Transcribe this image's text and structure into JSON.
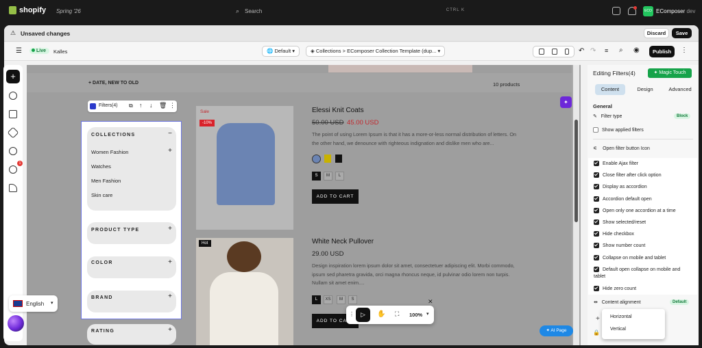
{
  "topbar": {
    "brand": "shopify",
    "edition": "Spring '26",
    "search_placeholder": "Search",
    "shortcut": "CTRL K",
    "avatar_initials": "ECO",
    "store_name": "EComposer",
    "store_suffix": "dev"
  },
  "savebar": {
    "message": "Unsaved changes",
    "discard": "Discard",
    "save": "Save"
  },
  "toolbar": {
    "status": "Live",
    "store": "Kalles",
    "theme": "Default",
    "template": "Collections > EComposer Collection Template (dup...",
    "publish": "Publish"
  },
  "canvas": {
    "sort_label": "DATE, NEW TO OLD",
    "product_count": "10 products",
    "filter_tag": "Filters(4)",
    "filters": {
      "collections_title": "COLLECTIONS",
      "items": [
        "Women Fashion",
        "Watches",
        "Men Fashion",
        "Skin care"
      ],
      "product_type": "PRODUCT TYPE",
      "color": "COLOR",
      "brand": "BRAND",
      "rating": "RATING"
    },
    "products": [
      {
        "badge": "Sale",
        "discount": "-10%",
        "title": "Elessi Knit Coats",
        "old_price": "50.00 USD",
        "price": "45.00 USD",
        "desc": "The point of using Lorem Ipsum is that it has a more-or-less normal distribution of letters. On the other hand, we denounce with righteous indignation and dislike men who are...",
        "sizes": [
          "S",
          "M",
          "L"
        ],
        "cta": "ADD TO CART"
      },
      {
        "badge": "Hot",
        "title": "White Neck Pullover",
        "price": "29.00 USD",
        "desc": "Design inspiration lorem ipsum dolor sit amet, consectetuer adipiscing elit. Morbi commodo, ipsum sed pharetra gravida, orci magna rhoncus neque, id pulvinar odio lorem non turpis. Nullam sit amet enim....",
        "sizes": [
          "L",
          "XS",
          "M",
          "S"
        ],
        "cta": "ADD TO CART"
      }
    ],
    "language": "English",
    "zoom": "100%",
    "ai_page": "AI Page"
  },
  "panel": {
    "title": "Editing Filters(4)",
    "magic": "Magic Touch",
    "tabs": [
      "Content",
      "Design",
      "Advanced"
    ],
    "section": "General",
    "filter_type_label": "Filter type",
    "filter_type_value": "Block",
    "show_applied": "Show applied filters",
    "open_icon": "Open filter button Icon",
    "options": [
      "Enable Ajax filter",
      "Close filter after click option",
      "Display as accordion",
      "Accordion default open",
      "Open only one accordion at a time",
      "Show selected/reset",
      "Hide checkbox",
      "Show number count",
      "Collapse on mobile and tablet",
      "Default open collapse on mobile and tablet",
      "Hide zero count"
    ],
    "alignment_label": "Content alignment",
    "alignment_value": "Default",
    "dropdown": [
      "Horizontal",
      "Vertical"
    ]
  }
}
